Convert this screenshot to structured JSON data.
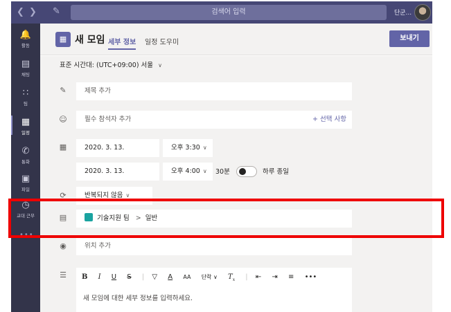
{
  "topbar": {
    "search_placeholder": "검색어 입력",
    "user_name": "단군...",
    "back_icon": "chevron-left-icon",
    "forward_icon": "chevron-right-icon",
    "compose_icon": "compose-icon"
  },
  "rail": {
    "items": [
      {
        "label": "활동",
        "icon": "bell-icon"
      },
      {
        "label": "채팅",
        "icon": "chat-icon"
      },
      {
        "label": "팀",
        "icon": "teams-icon"
      },
      {
        "label": "일정",
        "icon": "calendar-icon",
        "active": true
      },
      {
        "label": "통화",
        "icon": "phone-icon"
      },
      {
        "label": "파일",
        "icon": "file-icon"
      },
      {
        "label": "교대 근무",
        "icon": "shifts-icon"
      }
    ],
    "more": "•••"
  },
  "header": {
    "title": "새 모임",
    "tabs": [
      {
        "label": "세부 정보",
        "active": true
      },
      {
        "label": "일정 도우미"
      }
    ],
    "send_label": "보내기"
  },
  "form": {
    "timezone": "표준 시간대: (UTC+09:00) 서울",
    "title_placeholder": "제목 추가",
    "attendees_placeholder": "필수 참석자 추가",
    "add_optional": "+ 선택 사항",
    "start_date": "2020. 3. 13.",
    "start_time": "오후 3:30",
    "end_date": "2020. 3. 13.",
    "end_time": "오후 4:00",
    "duration": "30분",
    "all_day_label": "하루 종일",
    "all_day": false,
    "repeat": "반복되지 않음",
    "channel_team": "기술지원 팀",
    "channel_separator": ">",
    "channel_name": "일반",
    "location_placeholder": "위치 추가",
    "editor_placeholder": "새 모임에 대한 세부 정보를 입력하세요.",
    "toolbar": {
      "bold": "B",
      "italic": "I",
      "underline": "U",
      "strike": "S",
      "highlight": "A",
      "font_color": "A",
      "font_size": "AA",
      "paragraph": "단락",
      "clear": "T",
      "more": "•••"
    }
  },
  "colors": {
    "accent": "#6264a7",
    "rail": "#33344a",
    "topbar": "#464775",
    "highlight_box": "#ee0000"
  }
}
